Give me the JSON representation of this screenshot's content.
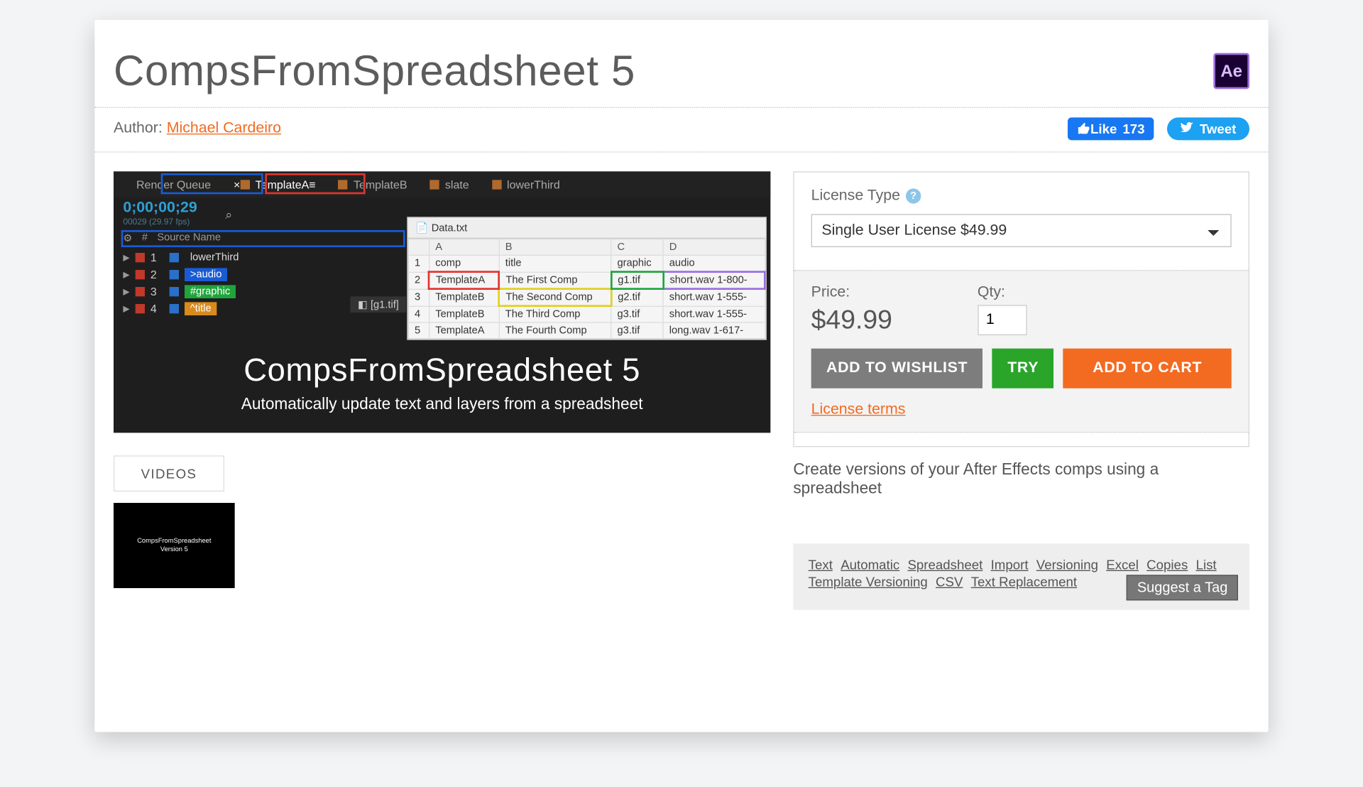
{
  "title": "CompsFromSpreadsheet 5",
  "author_label": "Author: ",
  "author_name": "Michael Cardeiro",
  "social": {
    "like_label": "Like",
    "like_count": "173",
    "tweet_label": "Tweet"
  },
  "hero": {
    "tabs": [
      "Render Queue",
      "TemplateA",
      "TemplateB",
      "slate",
      "lowerThird"
    ],
    "timecode": "0;00;00;29",
    "timecode_sub": "00029 (29.97 fps)",
    "source_name_hdr": "Source Name",
    "layers": [
      {
        "num": "1",
        "name": "lowerThird",
        "cls": ""
      },
      {
        "num": "2",
        "name": ">audio",
        "cls": "blue"
      },
      {
        "num": "3",
        "name": "#graphic",
        "cls": "green"
      },
      {
        "num": "4",
        "name": "^title",
        "cls": "orange"
      }
    ],
    "chip": "[g1.tif]",
    "data_file": "Data.txt",
    "data_headers": [
      "",
      "A",
      "B",
      "C",
      "D"
    ],
    "data_rows": [
      [
        "1",
        "comp",
        "title",
        "graphic",
        "audio"
      ],
      [
        "2",
        "TemplateA",
        "The First Comp",
        "g1.tif",
        "short.wav 1-800-"
      ],
      [
        "3",
        "TemplateB",
        "The Second Comp",
        "g2.tif",
        "short.wav 1-555-"
      ],
      [
        "4",
        "TemplateB",
        "The Third Comp",
        "g3.tif",
        "short.wav 1-555-"
      ],
      [
        "5",
        "TemplateA",
        "The Fourth Comp",
        "g3.tif",
        "long.wav 1-617-"
      ]
    ],
    "overlay_title": "CompsFromSpreadsheet 5",
    "overlay_sub": "Automatically update text and layers from a spreadsheet"
  },
  "videos_tab": "VIDEOS",
  "thumb_text": "CompsFromSpreadsheet",
  "thumb_sub": "Version 5",
  "purchase": {
    "license_label": "License Type",
    "license_option": "Single User License $49.99",
    "price_label": "Price:",
    "price_value": "$49.99",
    "qty_label": "Qty:",
    "qty_value": "1",
    "wishlist": "ADD TO WISHLIST",
    "try": "TRY",
    "cart": "ADD TO CART",
    "terms": "License terms"
  },
  "description": "Create versions of your After Effects comps using a spreadsheet",
  "tags": [
    "Text",
    "Automatic",
    "Spreadsheet",
    "Import",
    "Versioning",
    "Excel",
    "Copies",
    "List",
    "Template Versioning",
    "CSV",
    "Text Replacement"
  ],
  "suggest_tag": "Suggest a Tag",
  "ae_badge": "Ae"
}
